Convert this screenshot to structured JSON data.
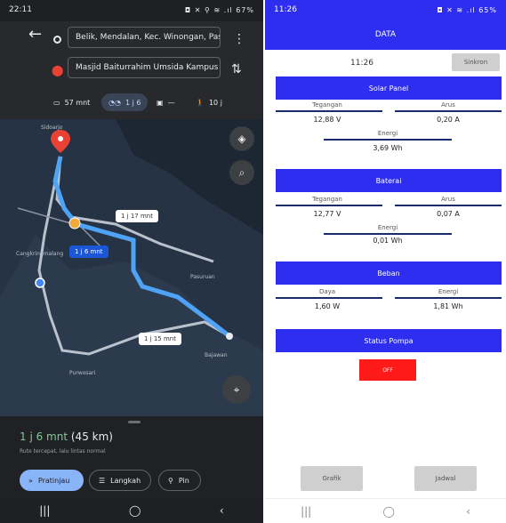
{
  "left": {
    "status": {
      "time": "22:11",
      "icons": "◘ ✕ ⚲ ≋ .ıl 67%"
    },
    "origin": "Belik, Mendalan, Kec. Winongan, Pasu...",
    "destination": "Masjid Baiturrahim Umsida Kampus 2",
    "modes": [
      {
        "label": "57 mnt",
        "icon": "car-icon"
      },
      {
        "label": "1 j 6",
        "icon": "motorbike-icon"
      },
      {
        "label": "—",
        "icon": "transit-icon"
      },
      {
        "label": "10 j",
        "icon": "walk-icon"
      }
    ],
    "map_labels": {
      "place_top": "Sidoarjo",
      "place_left": "Cangkringmalang",
      "place_mid": "Pasuruan",
      "place_right": "Bajawan",
      "place_bottom": "Purwosari"
    },
    "route_chips": {
      "alt1": "1 j 17 mnt",
      "primary": "1 j 6 mnt",
      "alt2": "1 j 15 mnt"
    },
    "eta_time": "1 j 6 mnt",
    "eta_distance": "(45 km)",
    "eta_sub": "Rute tercepat, lalu lintas normal",
    "buttons": {
      "start": "Pratinjau",
      "steps": "Langkah",
      "pin": "Pin"
    }
  },
  "right": {
    "status": {
      "time": "11:26",
      "icons": "◘ ✕ ≋ .ıl 65%"
    },
    "title": "DATA",
    "clock": "11:26",
    "sync": "Sinkron",
    "solar": {
      "title": "Solar Panel",
      "voltage_label": "Tegangan",
      "voltage": "12,88 V",
      "current_label": "Arus",
      "current": "0,20 A",
      "energy_label": "Energi",
      "energy": "3,69 Wh"
    },
    "battery": {
      "title": "Baterai",
      "voltage_label": "Tegangan",
      "voltage": "12,77 V",
      "current_label": "Arus",
      "current": "0,07 A",
      "energy_label": "Energi",
      "energy": "0,01 Wh"
    },
    "load": {
      "title": "Beban",
      "power_label": "Daya",
      "power": "1,60 W",
      "energy_label": "Energi",
      "energy": "1,81 Wh"
    },
    "pump_title": "Status Pompa",
    "pump_status": "OFF",
    "graph": "Grafik",
    "schedule": "Jadwal"
  },
  "colors": {
    "accent_blue": "#2e2ef0",
    "off_red": "#ff1a1a",
    "route_blue": "#4fa3f7"
  },
  "nav": {
    "recent": "|||",
    "home": "◯",
    "back": "‹"
  }
}
